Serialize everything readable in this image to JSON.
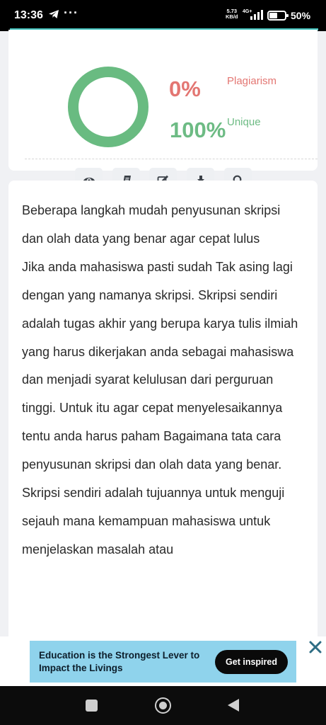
{
  "status_bar": {
    "time": "13:36",
    "more": "···",
    "speed_value": "5.73",
    "speed_unit": "KB/d",
    "network": "4G+",
    "battery": "50%"
  },
  "result": {
    "plagiarism_percent": "0%",
    "plagiarism_label": "Plagiarism",
    "unique_percent": "100%",
    "unique_label": "Unique",
    "unique_fraction": 1.0,
    "colors": {
      "plagiarism": "#e37672",
      "unique": "#6dbb84"
    }
  },
  "actions": [
    {
      "icon": "eye-icon"
    },
    {
      "icon": "book-icon"
    },
    {
      "icon": "edit-icon"
    },
    {
      "icon": "download-icon"
    },
    {
      "icon": "search-icon"
    }
  ],
  "article": {
    "paragraphs": [
      "Beberapa langkah mudah penyusunan skripsi dan olah data yang benar agar cepat lulus",
      "Jika anda mahasiswa pasti sudah Tak asing lagi dengan yang namanya skripsi. Skripsi sendiri adalah tugas akhir yang berupa karya tulis ilmiah yang harus dikerjakan anda sebagai mahasiswa dan menjadi syarat kelulusan dari perguruan tinggi. Untuk itu agar cepat menyelesaikannya tentu anda harus paham Bagaimana tata cara penyusunan skripsi dan olah data yang benar.",
      "Skripsi sendiri adalah tujuannya untuk menguji sejauh mana kemampuan mahasiswa untuk menjelaskan masalah atau"
    ]
  },
  "ad": {
    "text": "Education is the Strongest Lever to Impact the Livings",
    "button": "Get inspired",
    "background": "#8fd3ec"
  }
}
